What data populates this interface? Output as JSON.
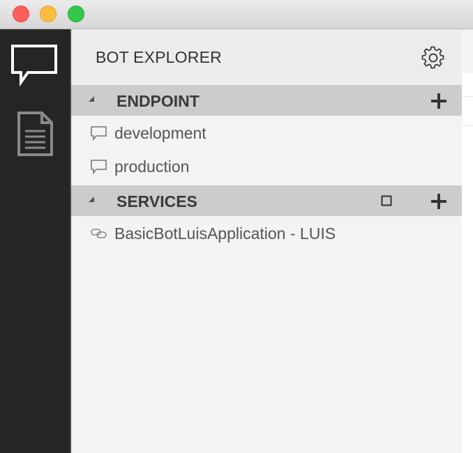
{
  "window": {
    "controls": [
      "close",
      "minimize",
      "maximize"
    ]
  },
  "activity_bar": {
    "items": [
      {
        "name": "chat-icon",
        "active": true
      },
      {
        "name": "document-icon",
        "active": false
      }
    ]
  },
  "explorer": {
    "title": "BOT EXPLORER",
    "settings_icon": "gear-icon",
    "sections": {
      "endpoint": {
        "label": "ENDPOINT",
        "items": [
          "development",
          "production"
        ]
      },
      "services": {
        "label": "SERVICES",
        "items": [
          "BasicBotLuisApplication - LUIS"
        ]
      }
    }
  },
  "colors": {
    "activity_bar_bg": "#252526",
    "section_header_bg": "#cccccc",
    "explorer_bg": "#f3f3f3",
    "close": "#fc605c",
    "minimize": "#fdbc40",
    "maximize": "#34c84a"
  }
}
